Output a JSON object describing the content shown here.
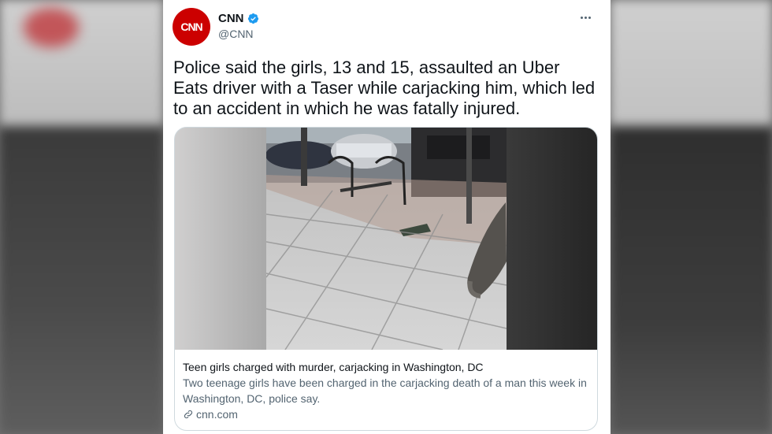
{
  "tweet": {
    "display_name": "CNN",
    "handle": "@CNN",
    "avatar_text": "CNN",
    "text": "Police said the girls, 13 and 15, assaulted an Uber Eats driver with a Taser while carjacking him, which led to an accident in which he was fatally injured."
  },
  "card": {
    "title": "Teen girls charged with murder, carjacking in Washington, DC",
    "description": "Two teenage girls have been charged in the carjacking death of a man this week in Washington, DC, police say.",
    "domain": "cnn.com"
  },
  "colors": {
    "brand_red": "#cc0000",
    "verified_blue": "#1d9bf0",
    "text_primary": "#0f1419",
    "text_secondary": "#536471"
  },
  "icons": {
    "verified": "verified-badge-icon",
    "more": "more-options-icon",
    "link": "link-icon"
  }
}
